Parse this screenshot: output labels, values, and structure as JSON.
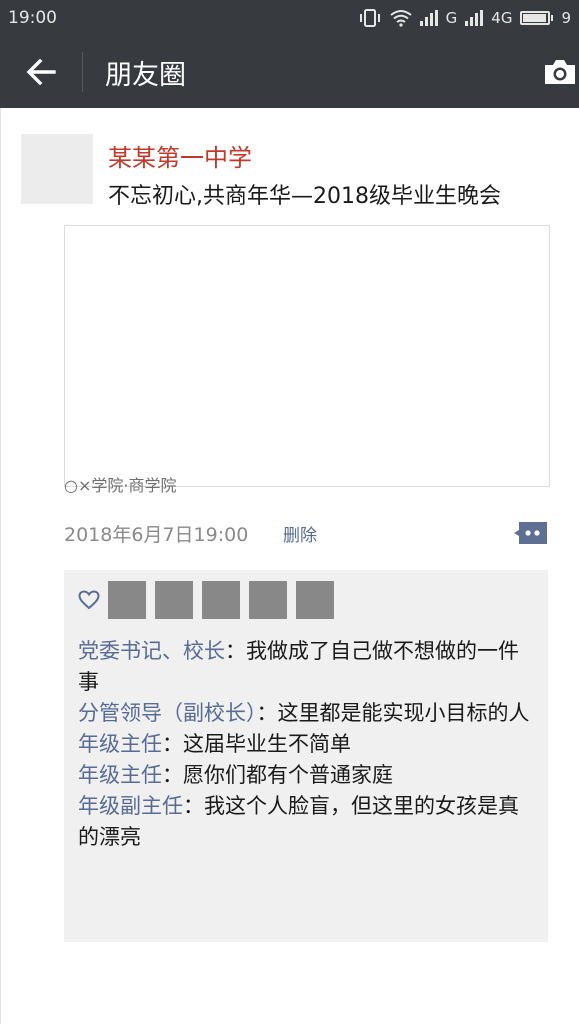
{
  "status_bar": {
    "time": "19:00",
    "network": "G",
    "network2": "4G",
    "battery_label": "9"
  },
  "nav": {
    "title": "朋友圈",
    "back_icon": "arrow-left-icon",
    "camera_icon": "camera-icon"
  },
  "post": {
    "author": "某某第一中学",
    "text": "不忘初心,共商年华—2018级毕业生晚会",
    "link_source": "○×学院·商学院",
    "timestamp": "2018年6月7日19:00",
    "delete_label": "删除"
  },
  "likes": {
    "icon": "heart-icon",
    "count_avatars": 5
  },
  "comments": [
    {
      "name": "党委书记、校长",
      "sep": "：",
      "text": "我做成了自己做不想做的一件事"
    },
    {
      "name": "分管领导（副校长）",
      "sep": "：",
      "text": "这里都是能实现小目标的人"
    },
    {
      "name": "年级主任",
      "sep": "：",
      "text": "这届毕业生不简单"
    },
    {
      "name": "年级主任",
      "sep": "：",
      "text": "愿你们都有个普通家庭"
    },
    {
      "name": "年级副主任",
      "sep": "：",
      "text": "我这个人脸盲，但这里的女孩是真的漂亮"
    }
  ],
  "colors": {
    "topbar": "#373a3f",
    "author": "#c0392b",
    "link": "#576b95",
    "panel": "#f0f0f0"
  }
}
